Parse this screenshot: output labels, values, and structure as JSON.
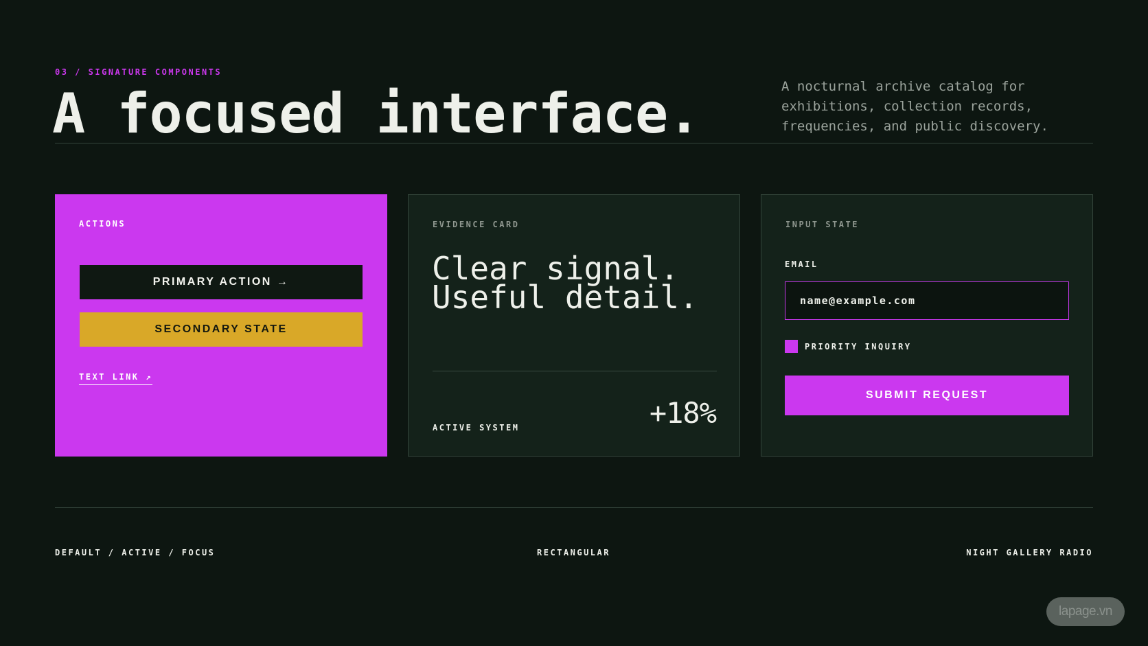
{
  "header": {
    "eyebrow": "03 / SIGNATURE COMPONENTS",
    "title": "A focused interface.",
    "description": "A nocturnal archive catalog for exhibitions, collection records, frequencies, and public discovery."
  },
  "cards": {
    "actions": {
      "label": "ACTIONS",
      "primary_button": "PRIMARY ACTION →",
      "secondary_button": "SECONDARY STATE",
      "text_link": "TEXT LINK ↗"
    },
    "evidence": {
      "label": "EVIDENCE CARD",
      "headline_line1": "Clear signal.",
      "headline_line2": "Useful detail.",
      "status": "ACTIVE SYSTEM",
      "metric": "+18%"
    },
    "input": {
      "label": "INPUT STATE",
      "field_label": "EMAIL",
      "email_value": "name@example.com",
      "checkbox_label": "PRIORITY INQUIRY",
      "checkbox_checked": true,
      "submit_button": "SUBMIT REQUEST"
    }
  },
  "footer": {
    "left": "DEFAULT / ACTIVE / FOCUS",
    "center": "RECTANGULAR",
    "right": "NIGHT GALLERY RADIO"
  },
  "watermark": "lapage.vn",
  "colors": {
    "background": "#0d1611",
    "accent": "#cb38ef",
    "secondary": "#d9a828",
    "card": "#14221a"
  }
}
